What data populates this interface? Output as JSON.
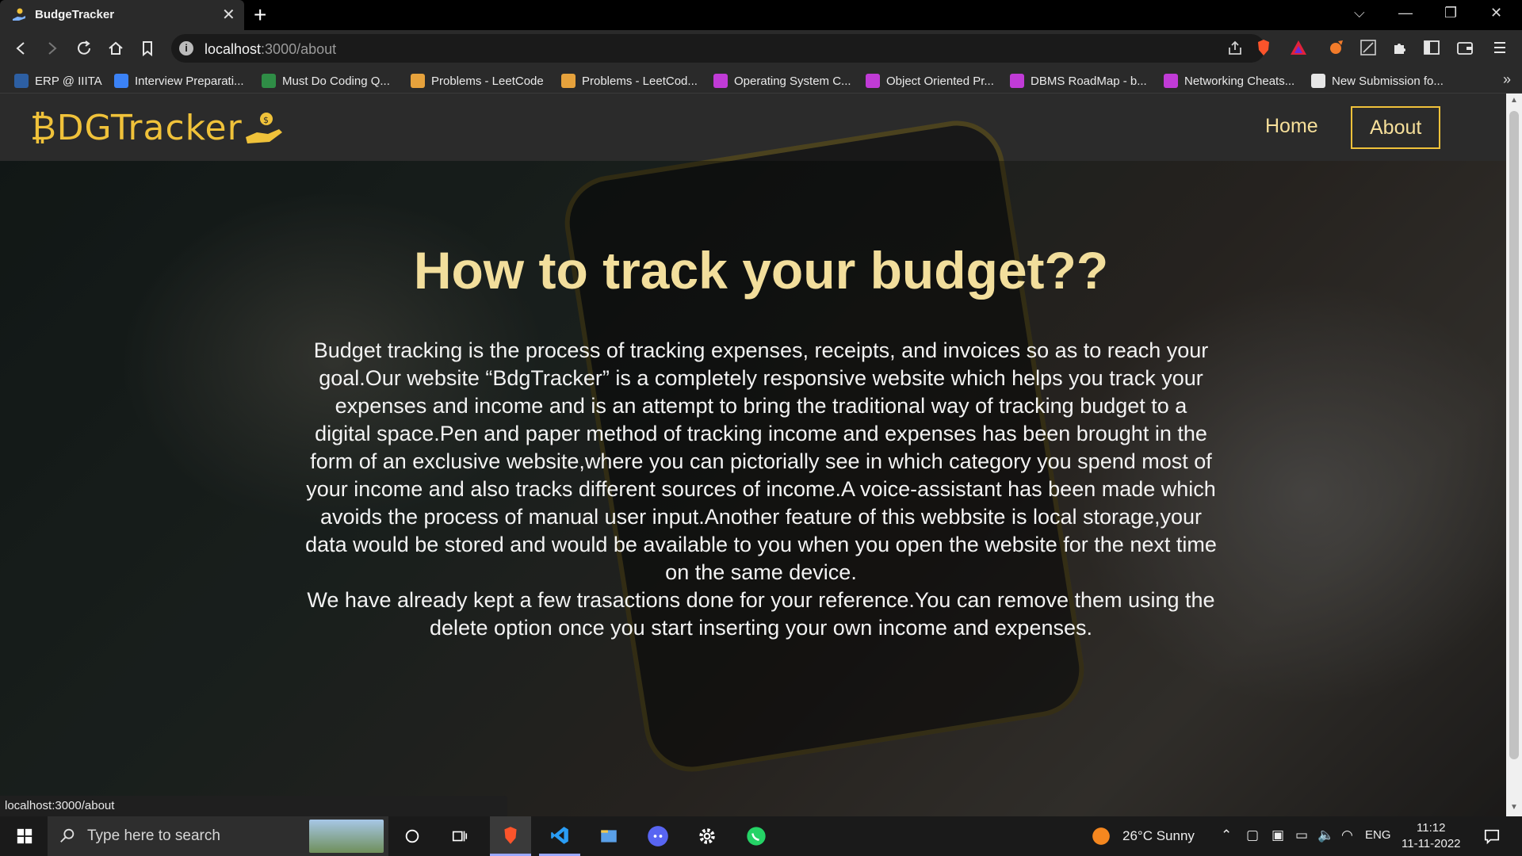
{
  "browser": {
    "tab": {
      "title": "BudgeTracker"
    },
    "url": {
      "host": "localhost",
      "path": ":3000/about"
    },
    "bookmarks": [
      "ERP @ IIITA",
      "Interview Preparati...",
      "Must Do Coding Q...",
      "Problems - LeetCode",
      "Problems - LeetCod...",
      "Operating System C...",
      "Object Oriented Pr...",
      "DBMS RoadMap - b...",
      "Networking Cheats...",
      "New Submission fo..."
    ],
    "status_url": "localhost:3000/about"
  },
  "site": {
    "logo": "₿DGTracker",
    "nav": {
      "home": "Home",
      "about": "About"
    },
    "hero": {
      "title": "How to track your budget??",
      "paragraph_1": "Budget tracking is the process of tracking expenses, receipts, and invoices so as to reach your goal.Our website “BdgTracker” is a completely responsive website which helps you track your expenses and income and is an attempt to bring the traditional way of tracking budget to a digital space.Pen and paper method of tracking income and expenses has been brought in the form of an exclusive website,where you can pictorially see in which category you spend most of your income and also tracks different sources of income.A voice-assistant has been made which avoids the process of manual user input.Another feature of this webbsite is local storage,your data would be stored and would be available to you when you open the website for the next time on the same device.",
      "paragraph_2": "We have already kept a few trasactions done for your reference.You can remove them using the delete option once you start inserting your own income and expenses."
    }
  },
  "taskbar": {
    "search_placeholder": "Type here to search",
    "weather": "26°C  Sunny",
    "language": "ENG",
    "time": "11:12",
    "date": "11-11-2022"
  },
  "colors": {
    "brand_gold": "#f0c23a",
    "heading_cream": "#f2de9c",
    "nav_bg": "#2b2b2b"
  }
}
